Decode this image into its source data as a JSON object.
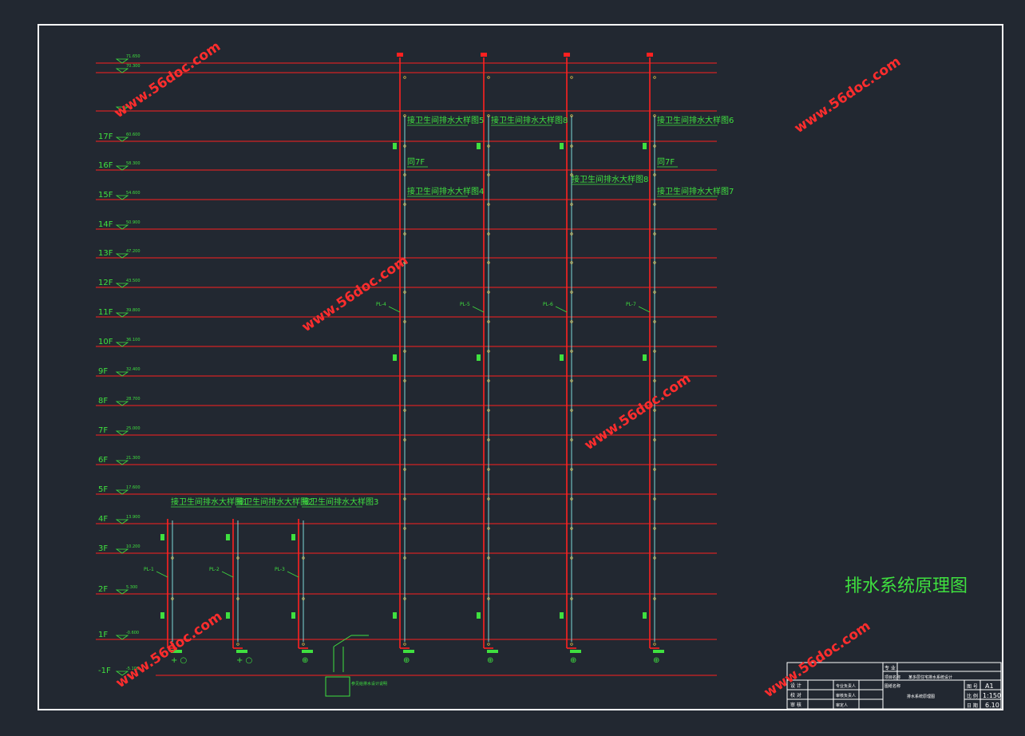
{
  "drawing_title": "排水系统原理图",
  "watermark": "www.56doc.com",
  "floors": [
    {
      "label": "",
      "elev": "71.650"
    },
    {
      "label": "",
      "elev": "70.300"
    },
    {
      "label": "",
      "elev": ""
    },
    {
      "label": "17F",
      "elev": "60.600"
    },
    {
      "label": "16F",
      "elev": "58.300"
    },
    {
      "label": "15F",
      "elev": "54.600"
    },
    {
      "label": "14F",
      "elev": "50.900"
    },
    {
      "label": "13F",
      "elev": "47.200"
    },
    {
      "label": "12F",
      "elev": "43.500"
    },
    {
      "label": "11F",
      "elev": "39.800"
    },
    {
      "label": "10F",
      "elev": "36.100"
    },
    {
      "label": "9F",
      "elev": "32.400"
    },
    {
      "label": "8F",
      "elev": "28.700"
    },
    {
      "label": "7F",
      "elev": "25.000"
    },
    {
      "label": "6F",
      "elev": "21.300"
    },
    {
      "label": "5F",
      "elev": "17.600"
    },
    {
      "label": "4F",
      "elev": "13.900"
    },
    {
      "label": "3F",
      "elev": "10.200"
    },
    {
      "label": "2F",
      "elev": "5.300"
    },
    {
      "label": "1F",
      "elev": "-0.600"
    },
    {
      "label": "-1F",
      "elev": "-5.100"
    }
  ],
  "pipe_labels": [
    "PL-1",
    "PL-2",
    "PL-3",
    "PL-4",
    "PL-5",
    "PL-6",
    "PL-7"
  ],
  "detail_labels": [
    "接卫生间排水大样图1",
    "接卫生间排水大样图2",
    "接卫生间排水大样图3",
    "接卫生间排水大样图4",
    "接卫生间排水大样图5",
    "接卫生间排水大样图8",
    "接卫生间排水大样图6",
    "接卫生间排水大样图8",
    "接卫生间排水大样图7"
  ],
  "roof_notes": [
    "同7F",
    "同7F"
  ],
  "bottom_symbols": [
    "+ ○",
    "+ ○",
    "⊕",
    "⊕",
    "⊕",
    "⊕",
    "⊕"
  ],
  "pump_note": "参见给排水设计说明",
  "title_block": {
    "left_rows": [
      {
        "role": "设 计",
        "name": "",
        "sign": "专业负责人"
      },
      {
        "role": "校 对",
        "name": "",
        "sign": "审核负责人"
      },
      {
        "role": "审 核",
        "name": "",
        "sign": "审定人"
      }
    ],
    "project_label": "项目名称",
    "project_value": "某多层住宅排水系统设计",
    "drawing_label": "图纸名称",
    "drawing_value": "排水系统原理图",
    "top_label": "专 业",
    "meta": [
      {
        "label": "图 号",
        "value": "A1"
      },
      {
        "label": "比 例",
        "value": "1:150"
      },
      {
        "label": "日 期",
        "value": "6.10"
      }
    ]
  },
  "colors": {
    "background": "#222831",
    "frame": "#ffffff",
    "floor_line": "#ff2020",
    "pipe": "#ff2020",
    "cyan_pipe": "#7fd8d8",
    "text_green": "#3fe03f",
    "watermark": "#ff2d2d"
  }
}
